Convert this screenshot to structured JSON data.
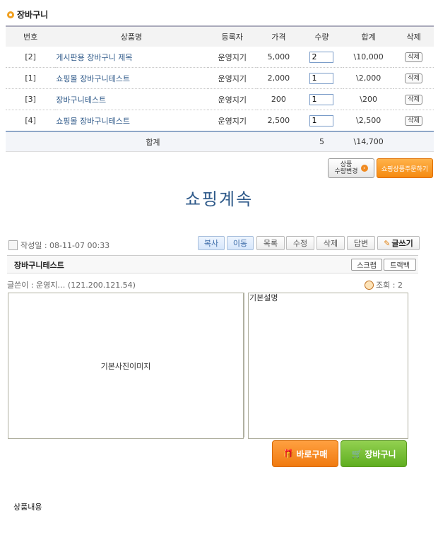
{
  "cart": {
    "title": "장바구니",
    "headers": [
      "번호",
      "상품명",
      "등록자",
      "가격",
      "수량",
      "합계",
      "삭제"
    ],
    "rows": [
      {
        "no": "[2]",
        "name": "게시판용 장바구니 제목",
        "seller": "운영지기",
        "price": "5,000",
        "qty": "2",
        "total": "\\10,000",
        "del": "삭제"
      },
      {
        "no": "[1]",
        "name": "쇼핑몰 장바구니테스트",
        "seller": "운영지기",
        "price": "2,000",
        "qty": "1",
        "total": "\\2,000",
        "del": "삭제"
      },
      {
        "no": "[3]",
        "name": "장바구니테스트",
        "seller": "운영지기",
        "price": "200",
        "qty": "1",
        "total": "\\200",
        "del": "삭제"
      },
      {
        "no": "[4]",
        "name": "쇼핑몰 장바구니테스트",
        "seller": "운영지기",
        "price": "2,500",
        "qty": "1",
        "total": "\\2,500",
        "del": "삭제"
      }
    ],
    "sum_label": "합계",
    "sum_qty": "5",
    "sum_total": "\\14,700",
    "change_qty_line1": "상품",
    "change_qty_line2": "수량변경",
    "order_button": "쇼핑상품주문하기"
  },
  "continue_shopping": "쇼핑계속",
  "board": {
    "date": "작성일 : 08-11-07 00:33",
    "buttons": [
      "복사",
      "이동",
      "목록",
      "수정",
      "삭제",
      "답변",
      "글쓰기"
    ],
    "post_title": "장바구니테스트",
    "scrap": "스크랩",
    "trackback": "트랙백",
    "writer": "글쓴이 : 운영지… (121.200.121.54)",
    "views": "조회 : 2",
    "image_placeholder": "기본사진이미지",
    "description": "기본설명",
    "buy_now": "바로구매",
    "add_cart": "장바구니",
    "content_label": "상품내용"
  }
}
